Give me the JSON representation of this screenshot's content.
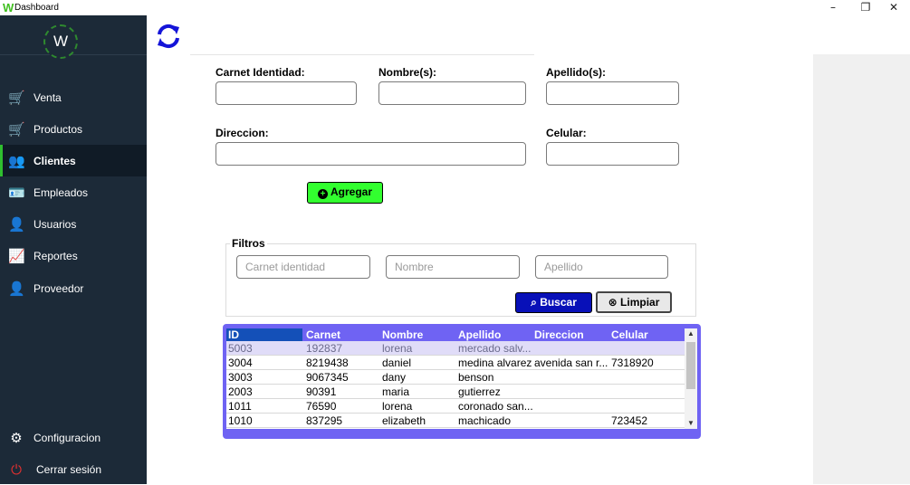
{
  "window": {
    "logo": "W",
    "title": "Dashboard",
    "controls": {
      "minimize": "–",
      "restore": "❐",
      "close": "✕"
    }
  },
  "sidebar": {
    "logo": "W",
    "items": [
      {
        "label": "Venta",
        "icon": "cart-icon",
        "glyph": "🛒"
      },
      {
        "label": "Productos",
        "icon": "cart-icon",
        "glyph": "🛒"
      },
      {
        "label": "Clientes",
        "icon": "people-icon",
        "glyph": "👥"
      },
      {
        "label": "Empleados",
        "icon": "badge-icon",
        "glyph": "🪪"
      },
      {
        "label": "Usuarios",
        "icon": "user-icon",
        "glyph": "👤"
      },
      {
        "label": "Reportes",
        "icon": "chart-icon",
        "glyph": "📈"
      },
      {
        "label": "Proveedor",
        "icon": "supplier-icon",
        "glyph": "👤"
      }
    ],
    "bottom": [
      {
        "label": "Configuracion",
        "icon": "gear-icon",
        "glyph": "⚙"
      },
      {
        "label": "Cerrar sesión",
        "icon": "logout-icon",
        "glyph": "⏻"
      }
    ]
  },
  "form": {
    "carnet_label": "Carnet Identidad:",
    "nombre_label": "Nombre(s):",
    "apellido_label": "Apellido(s):",
    "direccion_label": "Direccion:",
    "celular_label": "Celular:",
    "carnet_value": "",
    "nombre_value": "",
    "apellido_value": "",
    "direccion_value": "",
    "celular_value": "",
    "agregar_label": "Agregar"
  },
  "filters": {
    "title": "Filtros",
    "carnet_placeholder": "Carnet identidad",
    "nombre_placeholder": "Nombre",
    "apellido_placeholder": "Apellido",
    "buscar_label": "Buscar",
    "limpiar_label": "Limpiar"
  },
  "table": {
    "columns": [
      "ID",
      "Carnet",
      "Nombre",
      "Apellido",
      "Direccion",
      "Celular"
    ],
    "rows": [
      [
        "5003",
        "192837",
        "lorena",
        "mercado salv...",
        "",
        ""
      ],
      [
        "3004",
        "8219438",
        "daniel",
        "medina alvarez",
        "avenida san r...",
        "7318920"
      ],
      [
        "3003",
        "9067345",
        "dany",
        "benson",
        "",
        ""
      ],
      [
        "2003",
        "90391",
        "maria",
        "gutierrez",
        "",
        ""
      ],
      [
        "1011",
        "76590",
        "lorena",
        "coronado san...",
        "",
        ""
      ],
      [
        "1010",
        "837295",
        "elizabeth",
        "machicado",
        "",
        "723452"
      ]
    ],
    "selected_row": 0
  },
  "colors": {
    "sidebar": "#1c2a38",
    "accent_green": "#32ff2f",
    "buscar_blue": "#0810b8",
    "grid_purple": "#6f63f3",
    "refresh_blue": "#1414d8"
  }
}
